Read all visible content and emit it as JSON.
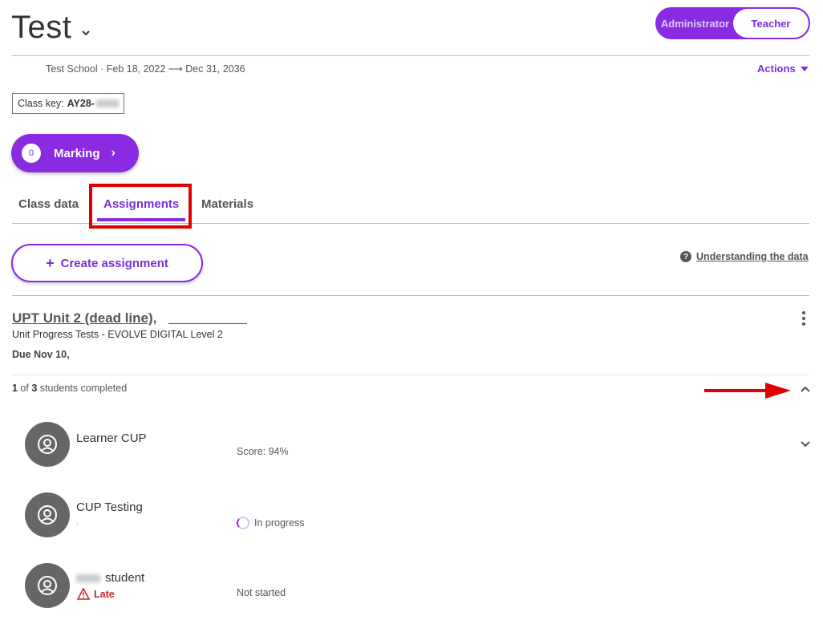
{
  "header": {
    "title": "Test",
    "roles": {
      "administrator": "Administrator",
      "teacher": "Teacher"
    },
    "meta": "Test School · Feb 18, 2022 ⟶ Dec 31, 2036",
    "actions_label": "Actions"
  },
  "class_key": {
    "label": "Class key:",
    "value": "AY28-"
  },
  "marking": {
    "count": "0",
    "label": "Marking"
  },
  "tabs": [
    {
      "label": "Class data"
    },
    {
      "label": "Assignments",
      "active": true
    },
    {
      "label": "Materials"
    }
  ],
  "toolbar": {
    "create_label": "Create assignment",
    "understanding_label": "Understanding the data"
  },
  "assignment": {
    "title": "UPT Unit 2 (dead line),",
    "subtitle": "Unit Progress Tests - EVOLVE DIGITAL Level 2",
    "due": "Due Nov 10,",
    "completed_count": "1",
    "completed_total": "3",
    "completed_text": "students completed"
  },
  "students": [
    {
      "name": "Learner CUP",
      "status": "Score: 94%",
      "note": ""
    },
    {
      "name": "CUP Testing",
      "status": "In progress",
      "note": "."
    },
    {
      "name": "student",
      "status": "Not started",
      "late_label": "Late"
    }
  ],
  "colors": {
    "accent": "#8a2be2",
    "late": "#c62828",
    "annotation": "#e00000"
  }
}
